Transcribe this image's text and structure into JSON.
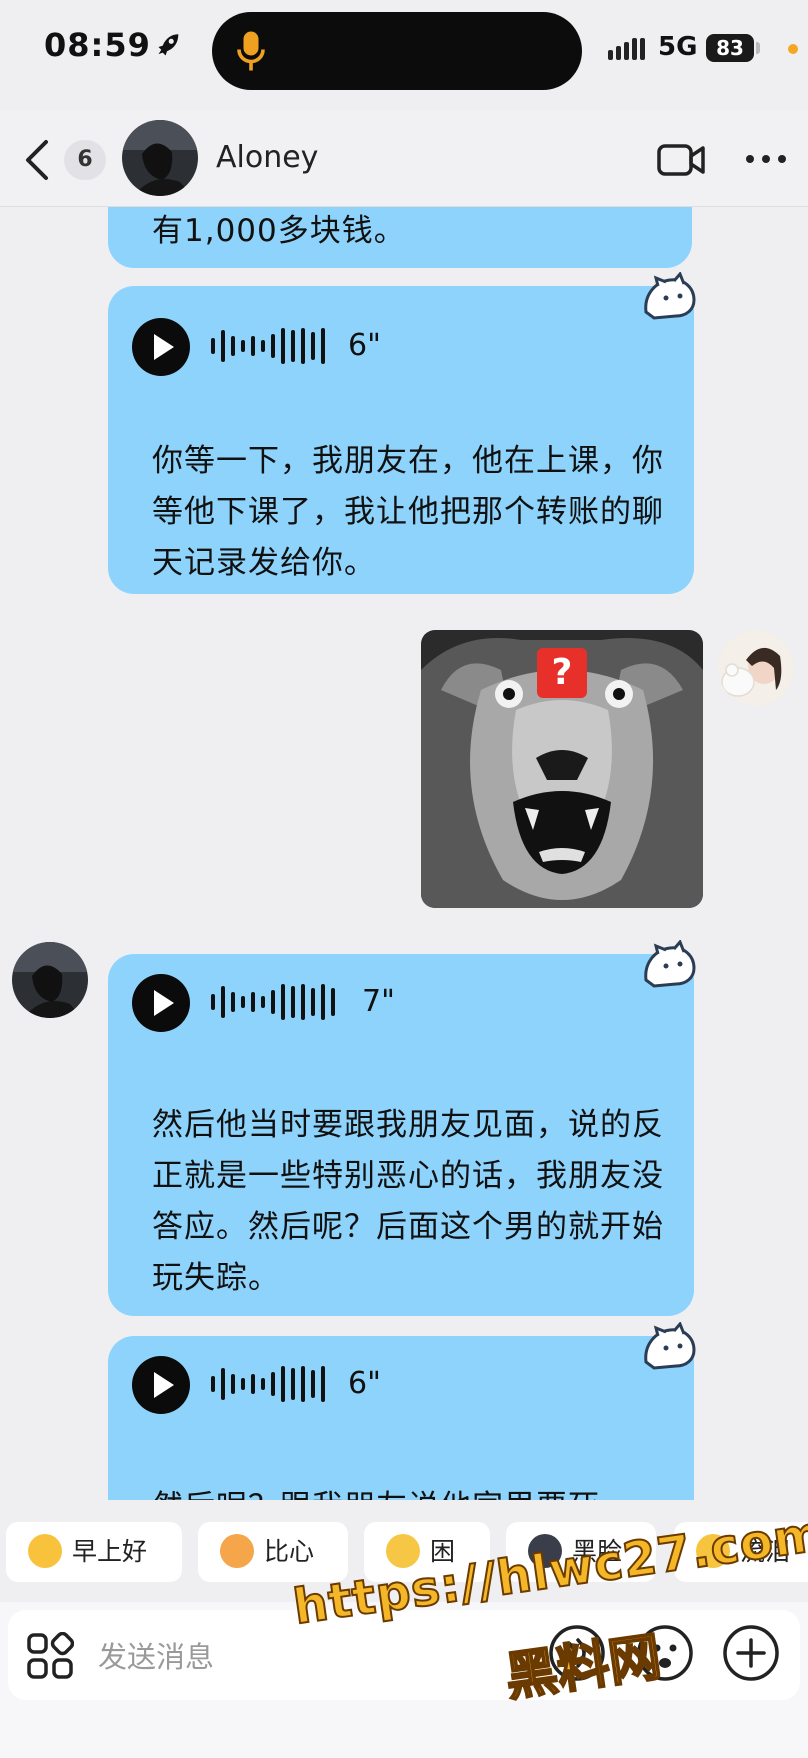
{
  "status_bar": {
    "time": "08:59",
    "network": "5G",
    "battery": "83"
  },
  "header": {
    "unread_count": "6",
    "contact_name": "Aloney"
  },
  "messages": [
    {
      "type": "text",
      "side": "left",
      "text": "有1,000多块钱。"
    },
    {
      "type": "voice",
      "side": "left",
      "duration": "6\"",
      "transcript": "你等一下，我朋友在，他在上课，你等他下课了，我让他把那个转账的聊天记录发给你。"
    },
    {
      "type": "image",
      "side": "right",
      "badge": "?"
    },
    {
      "type": "voice",
      "side": "left",
      "duration": "7\"",
      "transcript": "然后他当时要跟我朋友见面，说的反正就是一些特别恶心的话，我朋友没答应。然后呢？后面这个男的就开始玩失踪。"
    },
    {
      "type": "voice",
      "side": "left",
      "duration": "6\"",
      "transcript": "然后呢？跟我朋友说他家里要死"
    }
  ],
  "quick_reactions": [
    "早上好",
    "比心",
    "困",
    "黑脸",
    "流泪"
  ],
  "input": {
    "placeholder": "发送消息"
  },
  "watermark": {
    "url": "https://hlwc27.com",
    "name": "黑料网"
  },
  "colors": {
    "bubble": "#8ed3fb",
    "background": "#efeff1",
    "watermark": "#f4b728"
  }
}
